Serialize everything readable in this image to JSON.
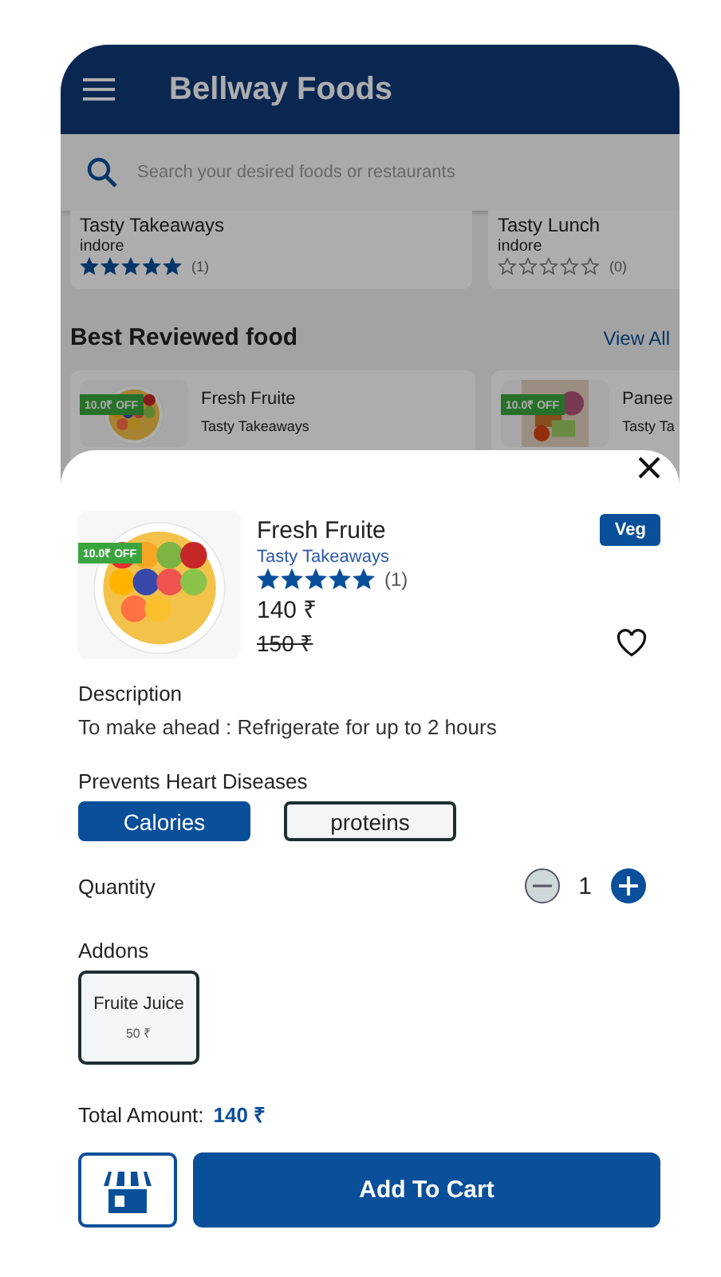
{
  "header": {
    "title": "Bellway Foods"
  },
  "search": {
    "placeholder": "Search your desired foods or restaurants"
  },
  "restaurants": [
    {
      "name": "Tasty Takeaways",
      "location": "indore",
      "stars": 5,
      "reviews": "(1)"
    },
    {
      "name": "Tasty Lunch",
      "location": "indore",
      "stars": 0,
      "reviews": "(0)"
    }
  ],
  "section": {
    "title": "Best Reviewed food",
    "link": "View All"
  },
  "foods": [
    {
      "name": "Fresh Fruite",
      "restaurant": "Tasty Takeaways",
      "discount": "10.0₹ OFF"
    },
    {
      "name": "Panee",
      "restaurant": "Tasty Ta",
      "discount": "10.0₹ OFF"
    }
  ],
  "detail": {
    "name": "Fresh Fruite",
    "restaurant": "Tasty Takeaways",
    "discount": "10.0₹ OFF",
    "badge": "Veg",
    "stars": 5,
    "reviews": "(1)",
    "price": "140 ₹",
    "old_price": "150 ₹",
    "favorite": false,
    "description_label": "Description",
    "description": "To make ahead : Refrigerate for up to 2 hours",
    "benefit_label": "Prevents Heart Diseases",
    "chips": [
      {
        "label": "Calories",
        "selected": true
      },
      {
        "label": "proteins",
        "selected": false
      }
    ],
    "quantity_label": "Quantity",
    "quantity": "1",
    "addons_label": "Addons",
    "addons": [
      {
        "name": "Fruite Juice",
        "price": "50 ₹"
      }
    ],
    "total_label": "Total Amount:",
    "total": "140 ₹",
    "cart_button": "Add To Cart"
  }
}
